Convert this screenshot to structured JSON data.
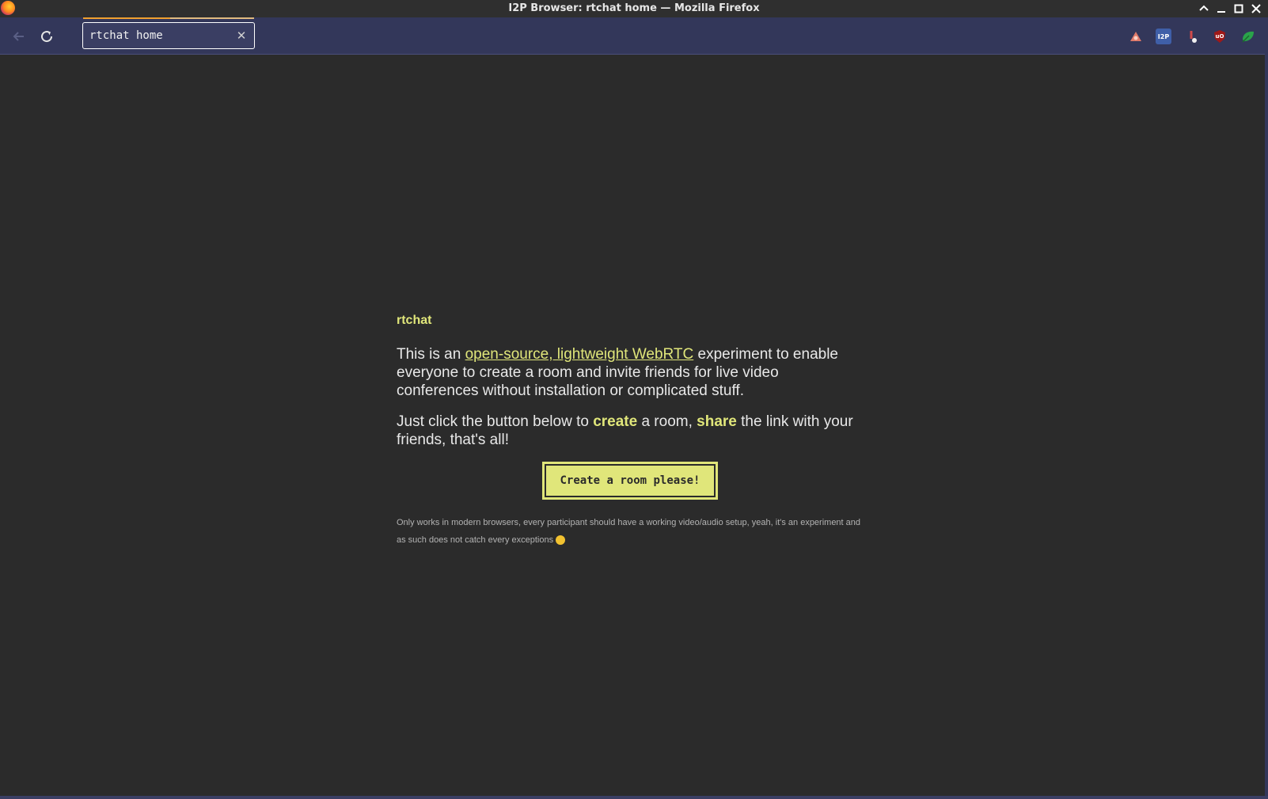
{
  "window": {
    "title": "I2P Browser: rtchat home — Mozilla Firefox"
  },
  "toolbar": {
    "url_value": "rtchat home",
    "extensions": [
      "i2p-router-icon",
      "i2pb-icon",
      "noscript-icon",
      "ublock-origin-icon",
      "green-leaf-icon"
    ],
    "extension_i2pb_label": "I2P",
    "extension_ublock_label": "uO"
  },
  "page": {
    "brand": "rtchat",
    "intro_before": "This is an ",
    "intro_link": "open-source, lightweight WebRTC",
    "intro_after": " experiment to enable everyone to create a room and invite friends for live video conferences without installation or complicated stuff.",
    "cta_part1": "Just click the button below to ",
    "cta_create": "create",
    "cta_part2": " a room, ",
    "cta_share": "share",
    "cta_part3": " the link with your friends, that's all!",
    "button_label": "Create a room please!",
    "note": "Only works in modern browsers, every participant should have a working video/audio setup, yeah, it's an experiment and as such does not catch every exceptions "
  },
  "colors": {
    "accent": "#e0e67a",
    "background": "#2b2b2b",
    "toolbar": "#33375a"
  }
}
